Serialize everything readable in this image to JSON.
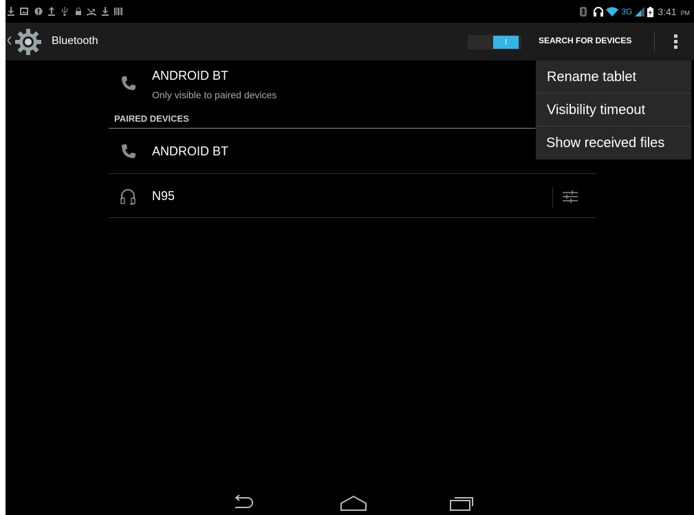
{
  "status_bar": {
    "time": "3:41",
    "ampm": "PM",
    "network_type": "3G",
    "left_icons": [
      "download-icon",
      "gallery-icon",
      "alert-icon",
      "upload-icon",
      "usb-icon",
      "lock-icon",
      "missed-call-icon",
      "download-icon",
      "barcode-icon"
    ],
    "right_icons": [
      "bluetooth-icon",
      "headset-icon",
      "wifi-icon",
      "signal-icon",
      "battery-icon"
    ]
  },
  "action_bar": {
    "title": "Bluetooth",
    "switch_state": "I",
    "search_label": "SEARCH FOR DEVICES"
  },
  "this_device": {
    "name": "ANDROID BT",
    "subtitle": "Only visible to paired devices"
  },
  "paired_section": {
    "header": "PAIRED DEVICES",
    "devices": [
      {
        "name": "ANDROID BT",
        "icon": "phone-icon"
      },
      {
        "name": "N95",
        "icon": "headphones-icon"
      }
    ]
  },
  "overflow_menu": {
    "items": [
      {
        "label": "Rename tablet"
      },
      {
        "label": "Visibility timeout"
      },
      {
        "label": "Show received files"
      }
    ]
  },
  "colors": {
    "accent": "#33b5e5",
    "background": "#000000",
    "action_bar": "#1c1c1c",
    "menu_background": "#282828"
  },
  "nav_bar": {
    "buttons": [
      "back-icon",
      "home-icon",
      "recent-apps-icon"
    ]
  }
}
